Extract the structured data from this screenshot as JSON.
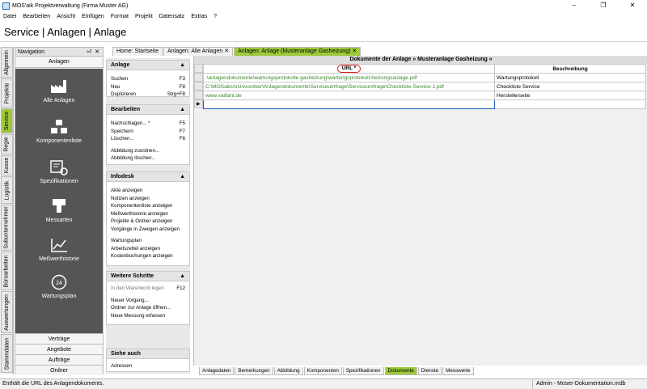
{
  "window": {
    "title": "MOS'aik Projektverwaltung (Firma Muster AG)"
  },
  "menu": [
    "Datei",
    "Bearbeiten",
    "Ansicht",
    "Einfügen",
    "Format",
    "Projekt",
    "Datensatz",
    "Extras",
    "?"
  ],
  "header": {
    "title": "Service | Anlagen | Anlage"
  },
  "vtabs": [
    "Allgemein",
    "Projekte",
    "Service",
    "Regie",
    "Kasse",
    "Logistik",
    "Subunternehmer",
    "Büroarbeiten",
    "Auswertungen",
    "Stammdaten"
  ],
  "navigation": {
    "title": "Navigation",
    "category": "Anlagen",
    "items": [
      "Alle Anlagen",
      "Komponentenliste",
      "Spezifikationen",
      "Messarten",
      "Meßwerthistorie",
      "Wartungsplan"
    ],
    "bottom": [
      "Verträge",
      "Angebote",
      "Aufträge",
      "Ordner"
    ]
  },
  "actions": {
    "anlage": {
      "title": "Anlage",
      "items": [
        {
          "label": "Suchen",
          "shortcut": "F3"
        },
        {
          "label": "Neu",
          "shortcut": "F8"
        },
        {
          "label": "Duplizieren",
          "shortcut": "Strg+F8"
        }
      ]
    },
    "bearbeiten": {
      "title": "Bearbeiten",
      "items": [
        {
          "label": "Nachschlagen... *",
          "shortcut": "F5"
        },
        {
          "label": "Speichern",
          "shortcut": "F7"
        },
        {
          "label": "Löschen...",
          "shortcut": "F6"
        },
        {
          "label": "Abbildung zuordnen...",
          "shortcut": ""
        },
        {
          "label": "Abbildung löschen...",
          "shortcut": ""
        }
      ]
    },
    "infodesk": {
      "title": "Infodesk",
      "items": [
        "Akte anzeigen",
        "Notizen anzeigen",
        "Komponentenliste anzeigen",
        "Meßwerthistorie anzeigen",
        "Projekte & Ordner anzeigen",
        "Vorgänge in Zweigen anzeigen",
        "Wartungsplan",
        "Arbeitszettel anzeigen",
        "Kostenbuchungen anzeigen"
      ]
    },
    "weitere": {
      "title": "Weitere Schritte",
      "items": [
        {
          "label": "In den Warenkorb legen",
          "shortcut": "F12"
        },
        {
          "label": "Neuer Vorgang...",
          "shortcut": ""
        },
        {
          "label": "Ordner zur Anlage öffnen...",
          "shortcut": ""
        },
        {
          "label": "Neue Messung erfassen",
          "shortcut": ""
        }
      ]
    },
    "siehe": {
      "title": "Siehe auch",
      "items": [
        "Adressen"
      ]
    }
  },
  "doc_tabs": [
    "Home: Startseite",
    "Anlagen: Alle Anlagen",
    "Anlagen: Anlage (Musteranlage Gasheizung)"
  ],
  "grid": {
    "title": "Dokumente der Anlage » Musteranlage Gasheizung «",
    "columns": [
      "URL *",
      "Beschreibung"
    ],
    "rows": [
      {
        "url": ".\\anlagendokumente\\wartungsprotokolle gasheizung\\wartungsprotokoll-heizungsanlage.pdf",
        "desc": "Wartungsprotokoll"
      },
      {
        "url": "C:\\MOSaik\\Archivordner\\Anlagendokumente\\Serviceumfrage\\Serviceumfrage\\Checkliste-Service-1.pdf",
        "desc": "Checkliste Service"
      },
      {
        "url": "www.vaillant.de",
        "desc": "Herstellerseite"
      }
    ]
  },
  "bottom_tabs": [
    "Anlagedaten",
    "Bemerkungen",
    "Abbildung",
    "Komponenten",
    "Spezifikationen",
    "Dokumente",
    "Dienste",
    "Messwerte"
  ],
  "status": {
    "left": "Enthält die URL des Anlagendokuments.",
    "right": "Admin - Moser-Dokumentation.mdb"
  }
}
